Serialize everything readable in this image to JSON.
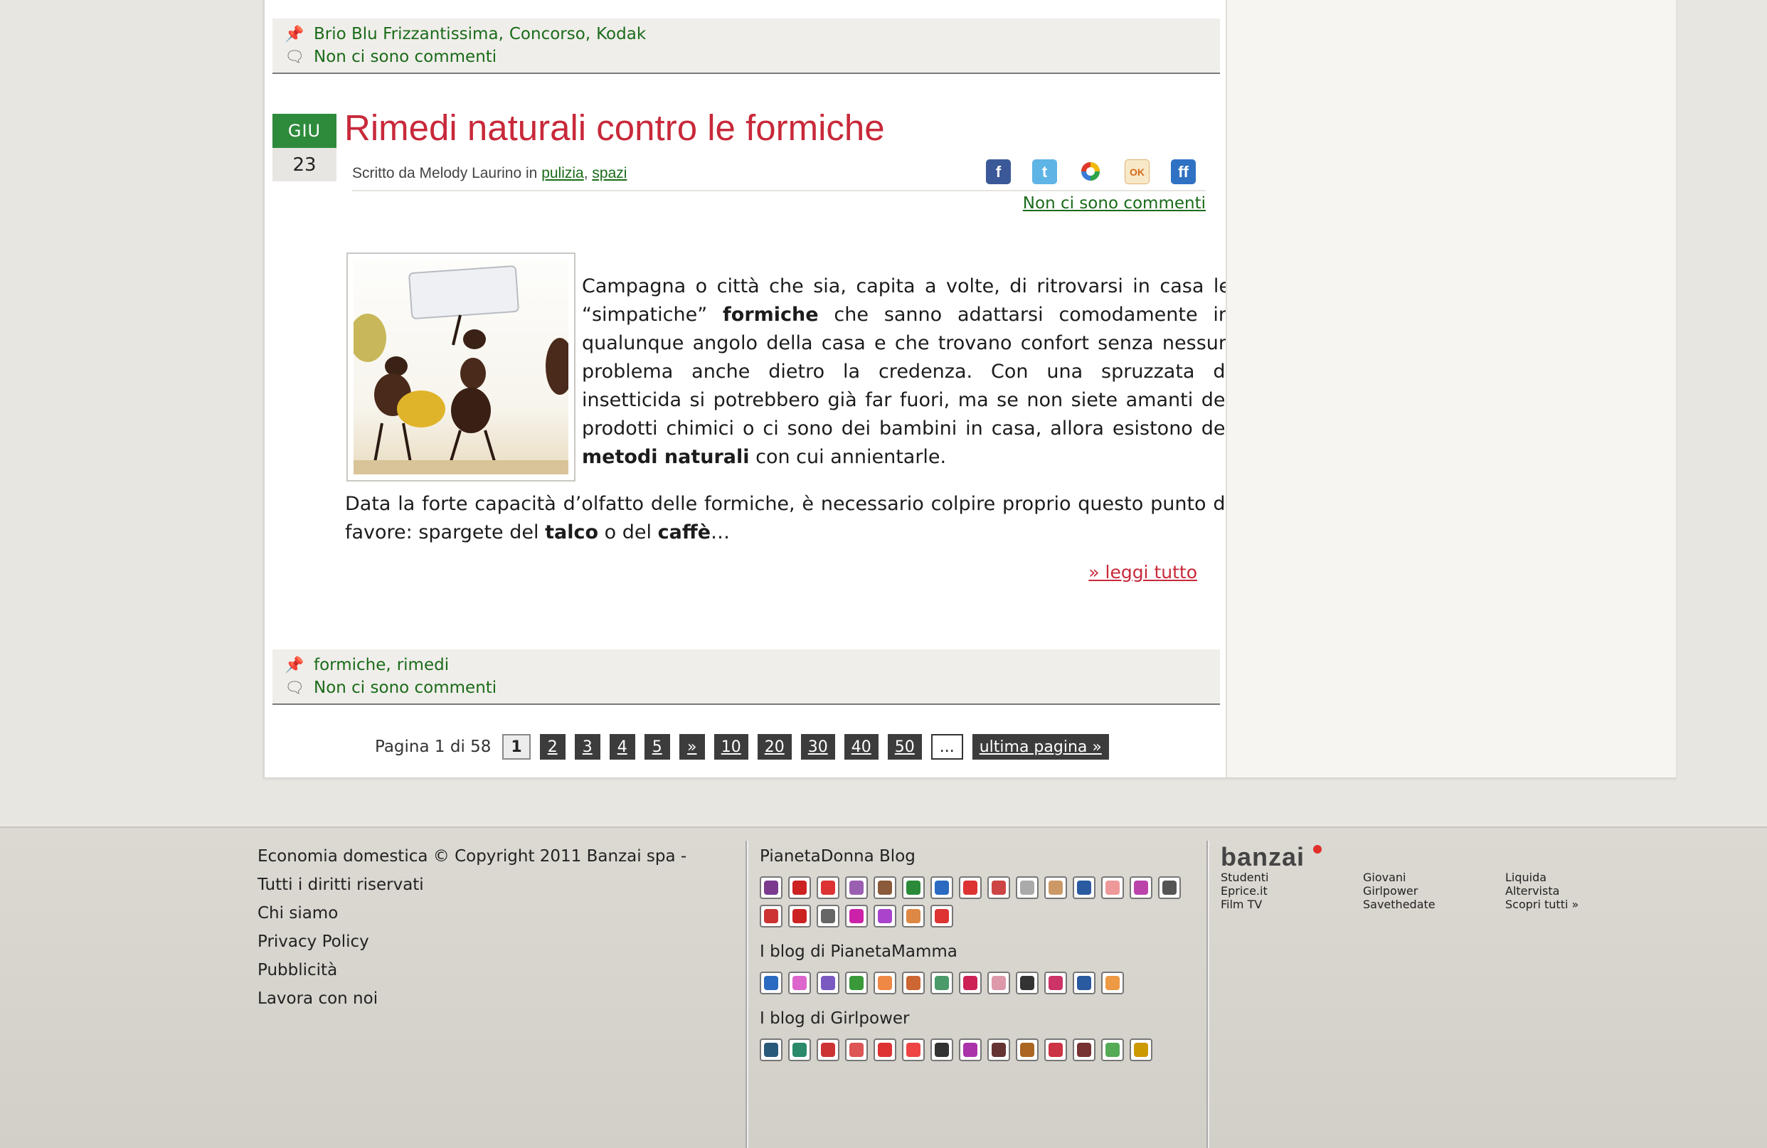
{
  "prev_post_meta": {
    "tags": [
      "Brio Blu Frizzantissima",
      "Concorso",
      "Kodak"
    ],
    "comments": "Non ci sono commenti"
  },
  "post": {
    "month": "GIU",
    "day": "23",
    "title": "Rimedi naturali contro le formiche",
    "byline_prefix": "Scritto da Melody Laurino",
    "byline_in": "in",
    "categories": [
      "pulizia",
      "spazi"
    ],
    "comments_link": "Non ci sono commenti",
    "share": [
      {
        "name": "facebook",
        "label": "f",
        "color": "#3b5998"
      },
      {
        "name": "twitter",
        "label": "t",
        "color": "#55acee"
      },
      {
        "name": "google-buzz",
        "label": "b",
        "color": "#3a7bd5"
      },
      {
        "name": "oknotizie",
        "label": "OK",
        "color": "#f0a030"
      },
      {
        "name": "friendfeed",
        "label": "ff",
        "color": "#2f72c4"
      }
    ],
    "p1_a": "Campagna o città che sia, capita a volte, di ritrovarsi in casa le “simpatiche”",
    "p1_bold1": "formiche",
    "p1_b": "che sanno adattarsi comodamente in qualunque angolo della casa e che trovano confort senza nessun problema anche dietro la credenza. Con una spruzzata di insetticida si potrebbero già far fuori, ma se non siete amanti dei prodotti chimici o ci sono dei bambini in casa, allora esistono dei",
    "p1_bold2": "metodi naturali",
    "p1_c": "con cui annientarle.",
    "p2_a": "Data la forte capacità d’olfatto delle formiche, è necessario colpire proprio questo punto di favore: spargete del",
    "p2_bold1": "talco",
    "p2_b": "o del",
    "p2_bold2": "caffè",
    "p2_c": "…",
    "read_more": "» leggi tutto",
    "tags": [
      "formiche",
      "rimedi"
    ],
    "tags_comments": "Non ci sono commenti"
  },
  "pager": {
    "label": "Pagina 1 di 58",
    "current": "1",
    "pages": [
      "2",
      "3",
      "4",
      "5",
      "»",
      "10",
      "20",
      "30",
      "40",
      "50"
    ],
    "dots": "...",
    "last": "ultima pagina »"
  },
  "footer": {
    "copyright": "Economia domestica © Copyright 2011 Banzai spa - Tutti i diritti riservati",
    "links": [
      "Chi siamo",
      "Privacy Policy",
      "Pubblicità",
      "Lavora con noi"
    ],
    "blog_groups": [
      {
        "heading": "PianetaDonna Blog",
        "icons": [
          "#7a3b8f",
          "#c22",
          "#d33",
          "#9a5fb0",
          "#8a5a3a",
          "#2a8a3a",
          "#2a6ac0",
          "#d33",
          "#c44",
          "#aaa",
          "#c96",
          "#2a5aa0",
          "#e99",
          "#b4a",
          "#555",
          "#c33",
          "#c22",
          "#666",
          "#c2a",
          "#a4c",
          "#d84",
          "#d33"
        ]
      },
      {
        "heading": "I blog di PianetaMamma",
        "icons": [
          "#2a6ac0",
          "#d6c",
          "#7a5ac0",
          "#3a9a3a",
          "#e84",
          "#c63",
          "#4a9a6a",
          "#c25",
          "#d9a",
          "#333",
          "#c36",
          "#2a5aa0",
          "#e94"
        ]
      },
      {
        "heading": "I blog di Girlpower",
        "icons": [
          "#2a5a7a",
          "#2a8a6a",
          "#c33",
          "#d55",
          "#d33",
          "#e44",
          "#333",
          "#a3a",
          "#633",
          "#a62",
          "#c34",
          "#733",
          "#5a5",
          "#c90"
        ]
      }
    ],
    "banzai_logo": "banzai",
    "partners": [
      "Studenti",
      "Giovani",
      "Liquida",
      "Eprice.it",
      "Girlpower",
      "Altervista",
      "Film TV",
      "Savethedate",
      "Scopri tutti »"
    ]
  }
}
